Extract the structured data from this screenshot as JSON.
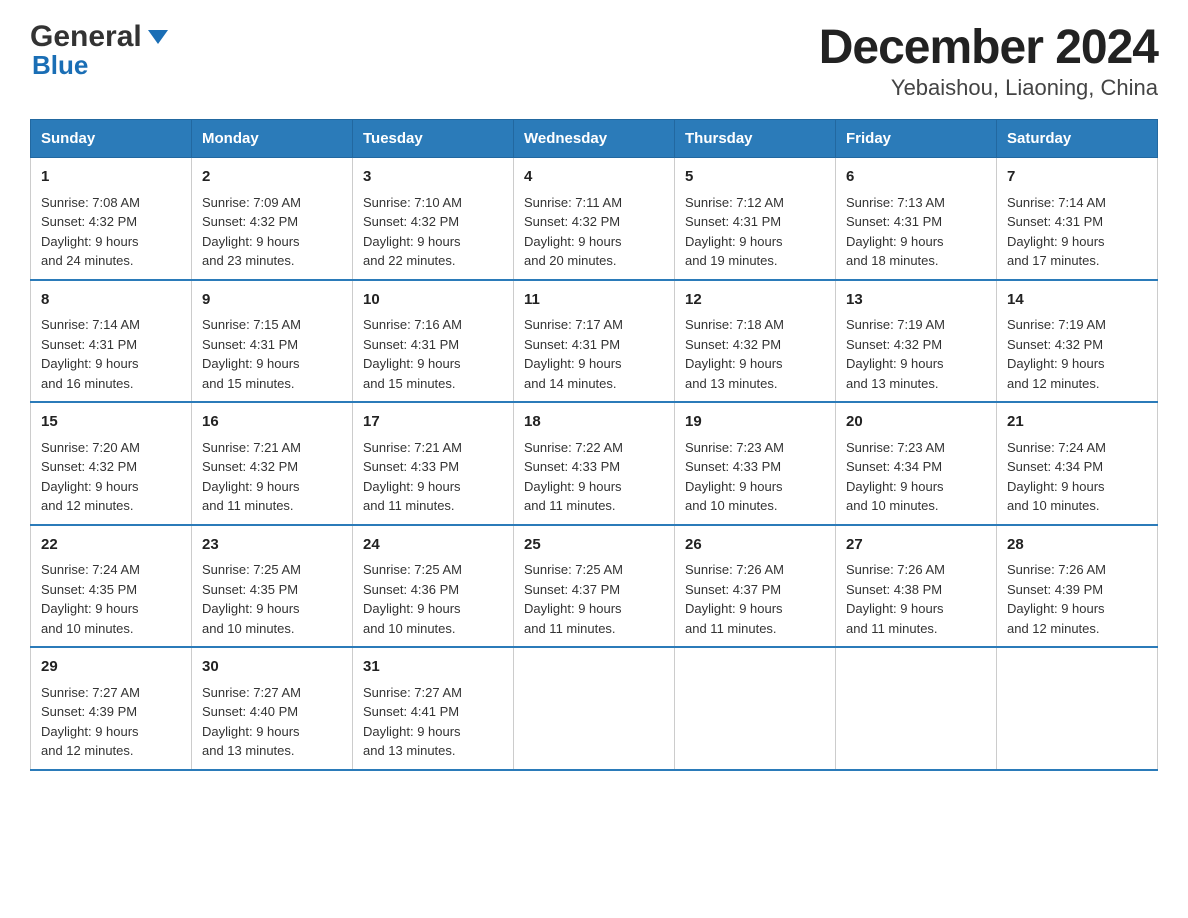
{
  "header": {
    "logo_general": "General",
    "logo_blue": "Blue",
    "title": "December 2024",
    "subtitle": "Yebaishou, Liaoning, China"
  },
  "days_of_week": [
    "Sunday",
    "Monday",
    "Tuesday",
    "Wednesday",
    "Thursday",
    "Friday",
    "Saturday"
  ],
  "weeks": [
    [
      {
        "day": "1",
        "sunrise": "7:08 AM",
        "sunset": "4:32 PM",
        "daylight": "9 hours and 24 minutes."
      },
      {
        "day": "2",
        "sunrise": "7:09 AM",
        "sunset": "4:32 PM",
        "daylight": "9 hours and 23 minutes."
      },
      {
        "day": "3",
        "sunrise": "7:10 AM",
        "sunset": "4:32 PM",
        "daylight": "9 hours and 22 minutes."
      },
      {
        "day": "4",
        "sunrise": "7:11 AM",
        "sunset": "4:32 PM",
        "daylight": "9 hours and 20 minutes."
      },
      {
        "day": "5",
        "sunrise": "7:12 AM",
        "sunset": "4:31 PM",
        "daylight": "9 hours and 19 minutes."
      },
      {
        "day": "6",
        "sunrise": "7:13 AM",
        "sunset": "4:31 PM",
        "daylight": "9 hours and 18 minutes."
      },
      {
        "day": "7",
        "sunrise": "7:14 AM",
        "sunset": "4:31 PM",
        "daylight": "9 hours and 17 minutes."
      }
    ],
    [
      {
        "day": "8",
        "sunrise": "7:14 AM",
        "sunset": "4:31 PM",
        "daylight": "9 hours and 16 minutes."
      },
      {
        "day": "9",
        "sunrise": "7:15 AM",
        "sunset": "4:31 PM",
        "daylight": "9 hours and 15 minutes."
      },
      {
        "day": "10",
        "sunrise": "7:16 AM",
        "sunset": "4:31 PM",
        "daylight": "9 hours and 15 minutes."
      },
      {
        "day": "11",
        "sunrise": "7:17 AM",
        "sunset": "4:31 PM",
        "daylight": "9 hours and 14 minutes."
      },
      {
        "day": "12",
        "sunrise": "7:18 AM",
        "sunset": "4:32 PM",
        "daylight": "9 hours and 13 minutes."
      },
      {
        "day": "13",
        "sunrise": "7:19 AM",
        "sunset": "4:32 PM",
        "daylight": "9 hours and 13 minutes."
      },
      {
        "day": "14",
        "sunrise": "7:19 AM",
        "sunset": "4:32 PM",
        "daylight": "9 hours and 12 minutes."
      }
    ],
    [
      {
        "day": "15",
        "sunrise": "7:20 AM",
        "sunset": "4:32 PM",
        "daylight": "9 hours and 12 minutes."
      },
      {
        "day": "16",
        "sunrise": "7:21 AM",
        "sunset": "4:32 PM",
        "daylight": "9 hours and 11 minutes."
      },
      {
        "day": "17",
        "sunrise": "7:21 AM",
        "sunset": "4:33 PM",
        "daylight": "9 hours and 11 minutes."
      },
      {
        "day": "18",
        "sunrise": "7:22 AM",
        "sunset": "4:33 PM",
        "daylight": "9 hours and 11 minutes."
      },
      {
        "day": "19",
        "sunrise": "7:23 AM",
        "sunset": "4:33 PM",
        "daylight": "9 hours and 10 minutes."
      },
      {
        "day": "20",
        "sunrise": "7:23 AM",
        "sunset": "4:34 PM",
        "daylight": "9 hours and 10 minutes."
      },
      {
        "day": "21",
        "sunrise": "7:24 AM",
        "sunset": "4:34 PM",
        "daylight": "9 hours and 10 minutes."
      }
    ],
    [
      {
        "day": "22",
        "sunrise": "7:24 AM",
        "sunset": "4:35 PM",
        "daylight": "9 hours and 10 minutes."
      },
      {
        "day": "23",
        "sunrise": "7:25 AM",
        "sunset": "4:35 PM",
        "daylight": "9 hours and 10 minutes."
      },
      {
        "day": "24",
        "sunrise": "7:25 AM",
        "sunset": "4:36 PM",
        "daylight": "9 hours and 10 minutes."
      },
      {
        "day": "25",
        "sunrise": "7:25 AM",
        "sunset": "4:37 PM",
        "daylight": "9 hours and 11 minutes."
      },
      {
        "day": "26",
        "sunrise": "7:26 AM",
        "sunset": "4:37 PM",
        "daylight": "9 hours and 11 minutes."
      },
      {
        "day": "27",
        "sunrise": "7:26 AM",
        "sunset": "4:38 PM",
        "daylight": "9 hours and 11 minutes."
      },
      {
        "day": "28",
        "sunrise": "7:26 AM",
        "sunset": "4:39 PM",
        "daylight": "9 hours and 12 minutes."
      }
    ],
    [
      {
        "day": "29",
        "sunrise": "7:27 AM",
        "sunset": "4:39 PM",
        "daylight": "9 hours and 12 minutes."
      },
      {
        "day": "30",
        "sunrise": "7:27 AM",
        "sunset": "4:40 PM",
        "daylight": "9 hours and 13 minutes."
      },
      {
        "day": "31",
        "sunrise": "7:27 AM",
        "sunset": "4:41 PM",
        "daylight": "9 hours and 13 minutes."
      },
      null,
      null,
      null,
      null
    ]
  ]
}
